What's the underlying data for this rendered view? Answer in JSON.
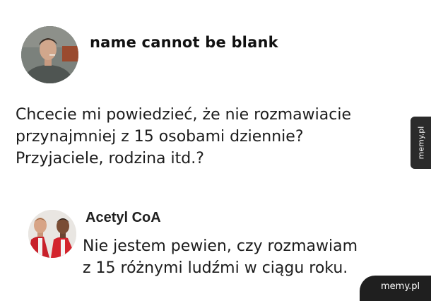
{
  "post": {
    "author": "name cannot be blank",
    "avatar_icon": "user-photo-man-with-cigarette",
    "text_lines": [
      "Chcecie mi powiedzieć, że nie rozmawiacie",
      "przynajmniej z 15 osobami dziennie?",
      "Przyjaciele, rodzina itd.?"
    ]
  },
  "reply": {
    "author": "Acetyl CoA",
    "avatar_icon": "user-photo-two-men-red-jackets",
    "text_lines": [
      "Nie jestem pewien, czy rozmawiam",
      "z 15 różnymi ludźmi w ciągu roku."
    ]
  },
  "watermark": {
    "side_label": "memy.pl",
    "corner_label": "memy.pl"
  }
}
